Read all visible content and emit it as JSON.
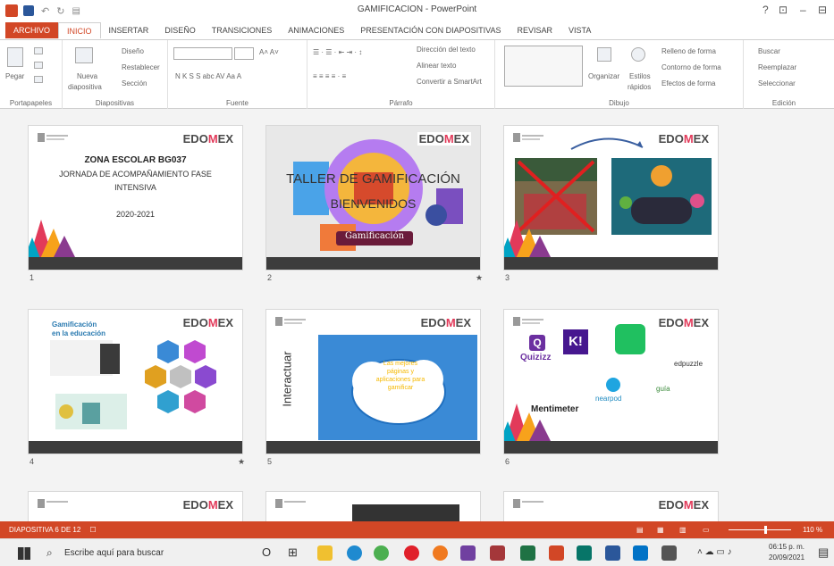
{
  "window": {
    "title": "GAMIFICACION - PowerPoint",
    "help": "?",
    "controls": [
      "⊡",
      "–",
      "⊟"
    ]
  },
  "tabs": [
    "ARCHIVO",
    "INICIO",
    "INSERTAR",
    "DISEÑO",
    "TRANSICIONES",
    "ANIMACIONES",
    "PRESENTACIÓN CON DIAPOSITIVAS",
    "REVISAR",
    "VISTA"
  ],
  "ribbon": {
    "portapapeles": {
      "label": "Portapapeles",
      "pegar": "Pegar"
    },
    "diapositivas": {
      "label": "Diapositivas",
      "nueva": "Nueva",
      "nueva2": "diapositiva",
      "diseno": "Diseño",
      "restablecer": "Restablecer",
      "seccion": "Sección"
    },
    "fuente": {
      "label": "Fuente",
      "styles": "N  K  S  S  abc  AV  Aa  A"
    },
    "parrafo": {
      "label": "Párrafo",
      "direccion": "Dirección del texto",
      "alinear": "Alinear texto",
      "convertir": "Convertir a SmartArt"
    },
    "dibujo": {
      "label": "Dibujo",
      "organizar": "Organizar",
      "estilos": "Estilos",
      "rapidos": "rápidos",
      "relleno": "Relleno de forma",
      "contorno": "Contorno de forma",
      "efectos": "Efectos de forma"
    },
    "edicion": {
      "label": "Edición",
      "buscar": "Buscar",
      "reemplazar": "Reemplazar",
      "seleccionar": "Seleccionar"
    }
  },
  "slides": {
    "brand": "EDO",
    "brand_mid": "M",
    "brand_end": "EX",
    "s1": {
      "num": "1",
      "line1": "ZONA ESCOLAR BG037",
      "line2": "JORNADA DE ACOMPAÑAMIENTO FASE",
      "line3": "INTENSIVA",
      "line4": "2020-2021"
    },
    "s2": {
      "num": "2",
      "line1": "TALLER DE GAMIFICACIÓN",
      "line2": "BIENVENIDOS",
      "badge": "Gamificación",
      "star": "★"
    },
    "s3": {
      "num": "3"
    },
    "s4": {
      "num": "4",
      "title1": "Gamificación",
      "title2": "en la educación",
      "star": "★"
    },
    "s5": {
      "num": "5",
      "side": "Interactuar",
      "cloud": "Las mejores páginas y aplicaciones para gamificar"
    },
    "s6": {
      "num": "6",
      "quizizz": "Quizizz",
      "kahoot": "K!",
      "edpuzzle": "edpuzzle",
      "nearpod": "nearpod",
      "mentimeter": "Mentimeter",
      "guia": "guía"
    }
  },
  "statusbar": {
    "slide": "DIAPOSITIVA 6 DE 12",
    "zoom": "110 %"
  },
  "taskbar": {
    "search": "Escribe aquí para buscar",
    "time": "06:15 p. m.",
    "date": "20/09/2021"
  }
}
